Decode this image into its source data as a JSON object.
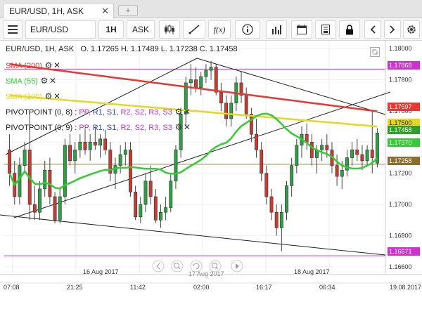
{
  "tab": {
    "label": "EUR/USD, 1H, ASK",
    "close": "✕",
    "add": "+"
  },
  "toolbar": {
    "symbol": "EUR/USD",
    "timeframe": "1H",
    "side": "ASK",
    "fx": "f(x)"
  },
  "header": {
    "title": "EUR/USD, 1H, ASK",
    "ohlc": "O. 1.17265 H. 1.17489 L. 1.17238 C. 1.17458"
  },
  "legend": [
    {
      "label": "SMA (200)",
      "color": "#e53935"
    },
    {
      "label": "SMA (55)",
      "color": "#33cc33"
    },
    {
      "label": "SMA (100)",
      "color": "#e6d820"
    },
    {
      "label": "PIVOTPOINT (0, 8)",
      "parts": [
        "PP,",
        "R1,",
        "S1,",
        "R2,",
        "S2,",
        "R3,",
        "S3"
      ]
    },
    {
      "label": "PIVOTPOINT (0, 9)",
      "parts": [
        "PP,",
        "R1,",
        "S1,",
        "R2,",
        "S2,",
        "R3,",
        "S3"
      ]
    }
  ],
  "chart_data": {
    "type": "candlestick",
    "instrument": "EUR/USD",
    "timeframe": "1H",
    "price_axis": {
      "ticks": [
        "1.18000",
        "1.17800",
        "1.17600",
        "1.17400",
        "1.17200",
        "1.17000",
        "1.16800",
        "1.16600"
      ],
      "min": 1.1655,
      "max": 1.1805
    },
    "time_labels": [
      "07:08",
      "21:25",
      "11:42",
      "02:00",
      "16:17",
      "06:34",
      "19.08.2017"
    ],
    "date_labels": [
      "16 Aug 2017",
      "17 Aug 2017",
      "18 Aug 2017"
    ],
    "price_tags": [
      {
        "value": "1.17868",
        "color": "#cc33cc"
      },
      {
        "value": "1.17597",
        "color": "#e53935"
      },
      {
        "value": "1.17500",
        "color": "#e6d820"
      },
      {
        "value": "1.17458",
        "color": "#2f9e2f"
      },
      {
        "value": "1.17370",
        "color": "#33cc33"
      },
      {
        "value": "1.17258",
        "color": "#8b6d2f"
      },
      {
        "value": "1.16671",
        "color": "#cc33cc"
      }
    ],
    "horizontal_levels": [
      {
        "value": 1.17868,
        "color": "#cc33cc"
      },
      {
        "value": 1.17258,
        "color": "#a08040"
      },
      {
        "value": 1.16671,
        "color": "#cc33cc"
      }
    ],
    "candles": [
      [
        1.1735,
        1.1745,
        1.1712,
        1.172
      ],
      [
        1.172,
        1.1728,
        1.17,
        1.1705
      ],
      [
        1.1705,
        1.173,
        1.17,
        1.1725
      ],
      [
        1.1725,
        1.174,
        1.172,
        1.1735
      ],
      [
        1.1735,
        1.176,
        1.169,
        1.17
      ],
      [
        1.17,
        1.1712,
        1.169,
        1.1695
      ],
      [
        1.1695,
        1.1715,
        1.169,
        1.171
      ],
      [
        1.171,
        1.1728,
        1.1705,
        1.1722
      ],
      [
        1.1722,
        1.173,
        1.17,
        1.1705
      ],
      [
        1.1705,
        1.1708,
        1.1688,
        1.169
      ],
      [
        1.169,
        1.171,
        1.1688,
        1.1705
      ],
      [
        1.1705,
        1.1742,
        1.17,
        1.1738
      ],
      [
        1.1738,
        1.1745,
        1.1725,
        1.1728
      ],
      [
        1.1728,
        1.174,
        1.172,
        1.1735
      ],
      [
        1.1735,
        1.1745,
        1.173,
        1.174
      ],
      [
        1.174,
        1.1748,
        1.1732,
        1.1735
      ],
      [
        1.1735,
        1.1745,
        1.1728,
        1.174
      ],
      [
        1.174,
        1.175,
        1.1735,
        1.1738
      ],
      [
        1.1738,
        1.1745,
        1.173,
        1.1742
      ],
      [
        1.1742,
        1.1748,
        1.1732,
        1.1735
      ],
      [
        1.1735,
        1.174,
        1.1715,
        1.172
      ],
      [
        1.172,
        1.173,
        1.171,
        1.1725
      ],
      [
        1.1725,
        1.1738,
        1.172,
        1.1732
      ],
      [
        1.1732,
        1.174,
        1.1725,
        1.1735
      ],
      [
        1.1735,
        1.174,
        1.1705,
        1.1708
      ],
      [
        1.1708,
        1.1712,
        1.169,
        1.1692
      ],
      [
        1.1692,
        1.1705,
        1.1688,
        1.17
      ],
      [
        1.17,
        1.172,
        1.1695,
        1.1715
      ],
      [
        1.1715,
        1.1725,
        1.17,
        1.1705
      ],
      [
        1.1705,
        1.171,
        1.1688,
        1.169
      ],
      [
        1.169,
        1.17,
        1.1685,
        1.1695
      ],
      [
        1.1695,
        1.1705,
        1.169,
        1.1698
      ],
      [
        1.1698,
        1.172,
        1.1695,
        1.1715
      ],
      [
        1.1715,
        1.1738,
        1.171,
        1.1735
      ],
      [
        1.1735,
        1.1762,
        1.173,
        1.1758
      ],
      [
        1.1758,
        1.1782,
        1.175,
        1.1778
      ],
      [
        1.1778,
        1.179,
        1.177,
        1.178
      ],
      [
        1.178,
        1.1788,
        1.1772,
        1.1775
      ],
      [
        1.1775,
        1.1785,
        1.177,
        1.1782
      ],
      [
        1.1782,
        1.179,
        1.1778,
        1.1786
      ],
      [
        1.1786,
        1.1792,
        1.178,
        1.1788
      ],
      [
        1.1788,
        1.179,
        1.177,
        1.1772
      ],
      [
        1.1772,
        1.1778,
        1.176,
        1.1765
      ],
      [
        1.1765,
        1.177,
        1.175,
        1.1755
      ],
      [
        1.1755,
        1.177,
        1.175,
        1.1765
      ],
      [
        1.1765,
        1.1782,
        1.176,
        1.1778
      ],
      [
        1.1778,
        1.1785,
        1.1765,
        1.177
      ],
      [
        1.177,
        1.1775,
        1.1755,
        1.1758
      ],
      [
        1.1758,
        1.1762,
        1.174,
        1.1745
      ],
      [
        1.1745,
        1.1755,
        1.173,
        1.1735
      ],
      [
        1.1735,
        1.174,
        1.1715,
        1.172
      ],
      [
        1.172,
        1.1725,
        1.17,
        1.1705
      ],
      [
        1.1705,
        1.171,
        1.169,
        1.1695
      ],
      [
        1.1695,
        1.17,
        1.168,
        1.1685
      ],
      [
        1.1685,
        1.17,
        1.167,
        1.1695
      ],
      [
        1.1695,
        1.1715,
        1.169,
        1.1712
      ],
      [
        1.1712,
        1.173,
        1.1705,
        1.1725
      ],
      [
        1.1725,
        1.1742,
        1.172,
        1.1738
      ],
      [
        1.1738,
        1.175,
        1.173,
        1.1745
      ],
      [
        1.1745,
        1.1752,
        1.1735,
        1.174
      ],
      [
        1.174,
        1.1745,
        1.1725,
        1.173
      ],
      [
        1.173,
        1.1738,
        1.172,
        1.1735
      ],
      [
        1.1735,
        1.1742,
        1.1728,
        1.1738
      ],
      [
        1.1738,
        1.1745,
        1.173,
        1.1735
      ],
      [
        1.1735,
        1.174,
        1.172,
        1.1725
      ],
      [
        1.1725,
        1.1732,
        1.1712,
        1.1718
      ],
      [
        1.1718,
        1.1728,
        1.171,
        1.1722
      ],
      [
        1.1722,
        1.1735,
        1.1718,
        1.173
      ],
      [
        1.173,
        1.174,
        1.1725,
        1.1735
      ],
      [
        1.1735,
        1.1742,
        1.1728,
        1.1732
      ],
      [
        1.1732,
        1.1738,
        1.1722,
        1.1728
      ],
      [
        1.1728,
        1.1738,
        1.1725,
        1.1735
      ],
      [
        1.1735,
        1.176,
        1.172,
        1.173
      ],
      [
        1.17265,
        1.17489,
        1.17238,
        1.17458
      ]
    ]
  },
  "navigation": {
    "icons": [
      "back-icon",
      "zoom-out-icon",
      "zoom-in-icon",
      "reset-icon",
      "forward-icon",
      "play-icon"
    ]
  }
}
